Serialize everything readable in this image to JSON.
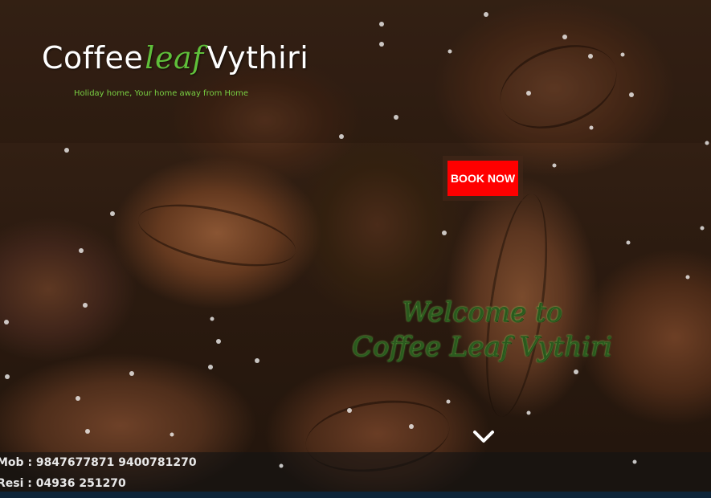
{
  "header": {
    "logo": {
      "part1": "Coffee",
      "part2": "leaf",
      "part3": "Vythiri"
    },
    "tagline": "Holiday home, Your home away from Home"
  },
  "book_button": {
    "label": "BOOK NOW",
    "color": "#ff0000"
  },
  "welcome": {
    "line1": "Welcome to",
    "line2": "Coffee Leaf Vythiri"
  },
  "scroll_down": {
    "icon": "chevron-down-icon"
  },
  "contact": {
    "mobile_label": "Mob :",
    "mobile_numbers": "9847677871 9400781270",
    "resi_label": "Resi :",
    "resi_number": "04936 251270"
  },
  "colors": {
    "accent_green": "#79d043",
    "button_red": "#ff0000"
  }
}
